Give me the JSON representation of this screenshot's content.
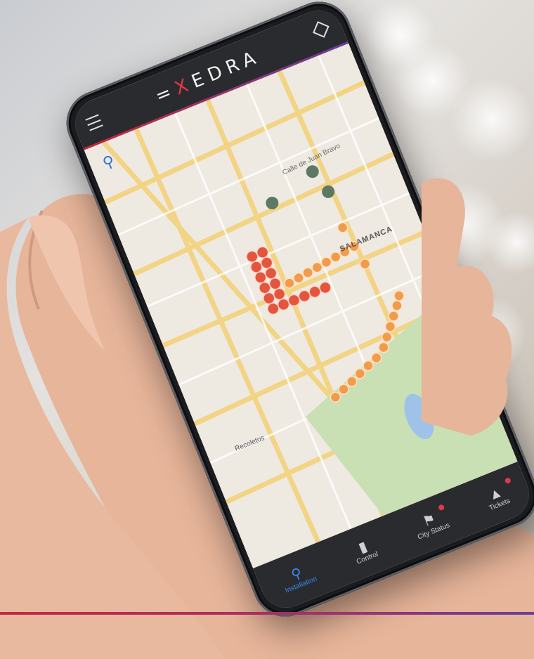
{
  "app": {
    "brand_prefix": "=",
    "brand_x": "X",
    "brand_rest": "EDRA"
  },
  "map": {
    "street_label": "Calle de Juan Bravo",
    "district_label": "SALAMANCA",
    "area_label": "Recoletos"
  },
  "tabs": [
    {
      "label": "Installation",
      "icon": "installation-icon",
      "active": true
    },
    {
      "label": "Control",
      "icon": "control-icon",
      "active": false
    },
    {
      "label": "City Status",
      "icon": "city-status-icon",
      "active": false
    },
    {
      "label": "Tickets",
      "icon": "tickets-icon",
      "active": false
    }
  ],
  "colors": {
    "brand_red": "#c6283e",
    "brand_purple": "#6a3e9b",
    "accent_blue": "#3d86e6",
    "marker_green": "#5c7a63",
    "marker_orange": "#f29b4a",
    "marker_red": "#e4553d"
  }
}
